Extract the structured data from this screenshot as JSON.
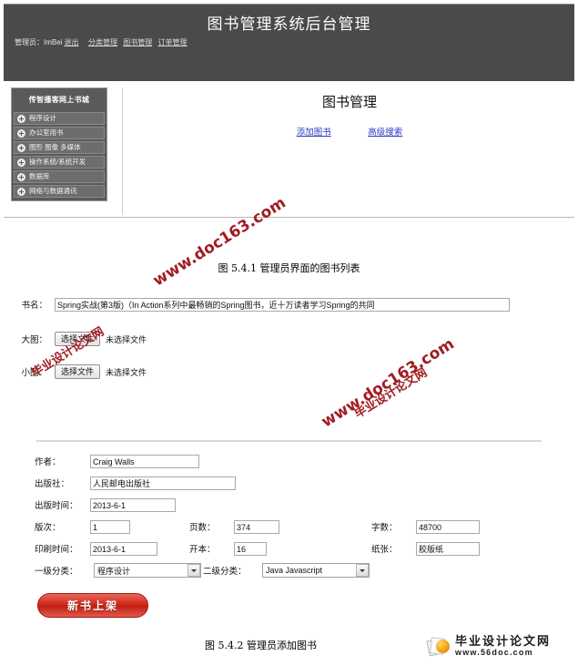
{
  "header": {
    "title": "图书管理系统后台管理",
    "admin_prefix": "管理员：",
    "admin_name": "ImBei",
    "logout_label": "退出",
    "nav": [
      {
        "label": "分类管理"
      },
      {
        "label": "图书管理"
      },
      {
        "label": "订单管理"
      }
    ]
  },
  "sidebar": {
    "title": "传智播客网上书城",
    "items": [
      {
        "label": "程序设计",
        "icon": "plus-circle-icon"
      },
      {
        "label": "办公室用书",
        "icon": "plus-circle-icon"
      },
      {
        "label": "图形 图像 多媒体",
        "icon": "plus-circle-icon"
      },
      {
        "label": "操作系统/系统开发",
        "icon": "plus-circle-icon"
      },
      {
        "label": "数据库",
        "icon": "plus-circle-icon"
      },
      {
        "label": "网络与数据通讯",
        "icon": "plus-circle-icon"
      }
    ]
  },
  "main": {
    "page_title": "图书管理",
    "links": [
      {
        "label": "添加图书"
      },
      {
        "label": "高级搜索"
      }
    ]
  },
  "captions": {
    "figure_1": "图 5.4.1  管理员界面的图书列表",
    "figure_2": "图 5.4.2  管理员添加图书"
  },
  "form": {
    "book_name": {
      "label": "书名：",
      "value": "Spring实战(第3版)（In Action系列中最畅销的Spring图书，近十万读者学习Spring的共同"
    },
    "big_image": {
      "label": "大图：",
      "button_label": "选择文件",
      "status": "未选择文件"
    },
    "small_image": {
      "label": "小图：",
      "button_label": "选择文件",
      "status": "未选择文件"
    },
    "author": {
      "label": "作者：",
      "value": "Craig Walls"
    },
    "publisher": {
      "label": "出版社：",
      "value": "人民邮电出版社"
    },
    "publish_date": {
      "label": "出版时间：",
      "value": "2013-6-1"
    },
    "edition": {
      "label": "版次：",
      "value": "1"
    },
    "pages": {
      "label": "页数：",
      "value": "374"
    },
    "words": {
      "label": "字数：",
      "value": "48700"
    },
    "print_date": {
      "label": "印刷时间：",
      "value": "2013-6-1"
    },
    "format": {
      "label": "开本：",
      "value": "16"
    },
    "paper": {
      "label": "纸张：",
      "value": "胶版纸"
    },
    "category_1": {
      "label": "一级分类：",
      "value": "程序设计",
      "icon": "chevron-down-icon"
    },
    "category_2": {
      "label": "二级分类：",
      "value": "Java Javascript",
      "icon": "chevron-down-icon"
    },
    "submit_label": "新书上架"
  },
  "brand": {
    "name_cn": "毕业设计论文网",
    "url": "www.56doc.com"
  },
  "watermarks": [
    {
      "text": "www.doc163.com"
    },
    {
      "text": "毕业设计论文网"
    },
    {
      "text": "www.doc163.com"
    },
    {
      "text": "毕业设计论文网"
    }
  ],
  "colors": {
    "header_bg": "#4a4a4a",
    "sidebar_bg": "#5a5a5a",
    "link": "#2b3fbf",
    "submit_red": "#cf2419",
    "watermark": "#a01d22"
  }
}
